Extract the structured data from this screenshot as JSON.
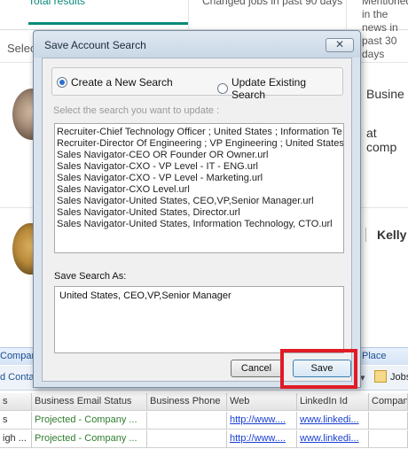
{
  "background": {
    "tabs": [
      {
        "label": "Total results"
      },
      {
        "label": "Changed jobs in past 90 days"
      },
      {
        "label": "Mentioned in the news in past 30 days"
      }
    ],
    "select_label": "Selec",
    "card1_name": "Busine",
    "card1_sub": "at comp",
    "card2_name": "Kelly",
    "bar_labels": {
      "left": "Compan",
      "right": "Place",
      "contact": "d Conta",
      "jobs": "Jobs"
    },
    "grid": {
      "headers": [
        "s",
        "Business Email Status",
        "Business Phone",
        "Web",
        "LinkedIn Id",
        "Compan"
      ],
      "rows": [
        [
          "s",
          "Projected - Company ...",
          "",
          "http://www....",
          "www.linkedi...",
          ""
        ],
        [
          "igh ...",
          "Projected - Company ...",
          "",
          "http://www....",
          "www.linkedi...",
          ""
        ]
      ]
    }
  },
  "dialog": {
    "title": "Save Account Search",
    "close_icon": "close-x-icon",
    "radio_options": [
      {
        "label": "Create a New Search",
        "selected": true
      },
      {
        "label": "Update Existing Search",
        "selected": false
      }
    ],
    "hint": "Select the search you want to update :",
    "searches": [
      "Recruiter-Chief Technology Officer ; United States ; Information Te",
      "Recruiter-Director Of Engineering ; VP Engineering ; United States ;",
      "Sales Navigator-CEO OR Founder OR Owner.url",
      "Sales Navigator-CXO - VP Level  -  IT - ENG.url",
      "Sales Navigator-CXO - VP Level  -  Marketing.url",
      "Sales Navigator-CXO Level.url",
      "Sales Navigator-United States, CEO,VP,Senior Manager.url",
      "Sales Navigator-United States, Director.url",
      "Sales Navigator-United States, Information Technology, CTO.url"
    ],
    "save_as_label": "Save Search As:",
    "save_as_value": "United States, CEO,VP,Senior Manager",
    "cancel_label": "Cancel",
    "save_label": "Save",
    "highlight_color": "#e01b24"
  }
}
